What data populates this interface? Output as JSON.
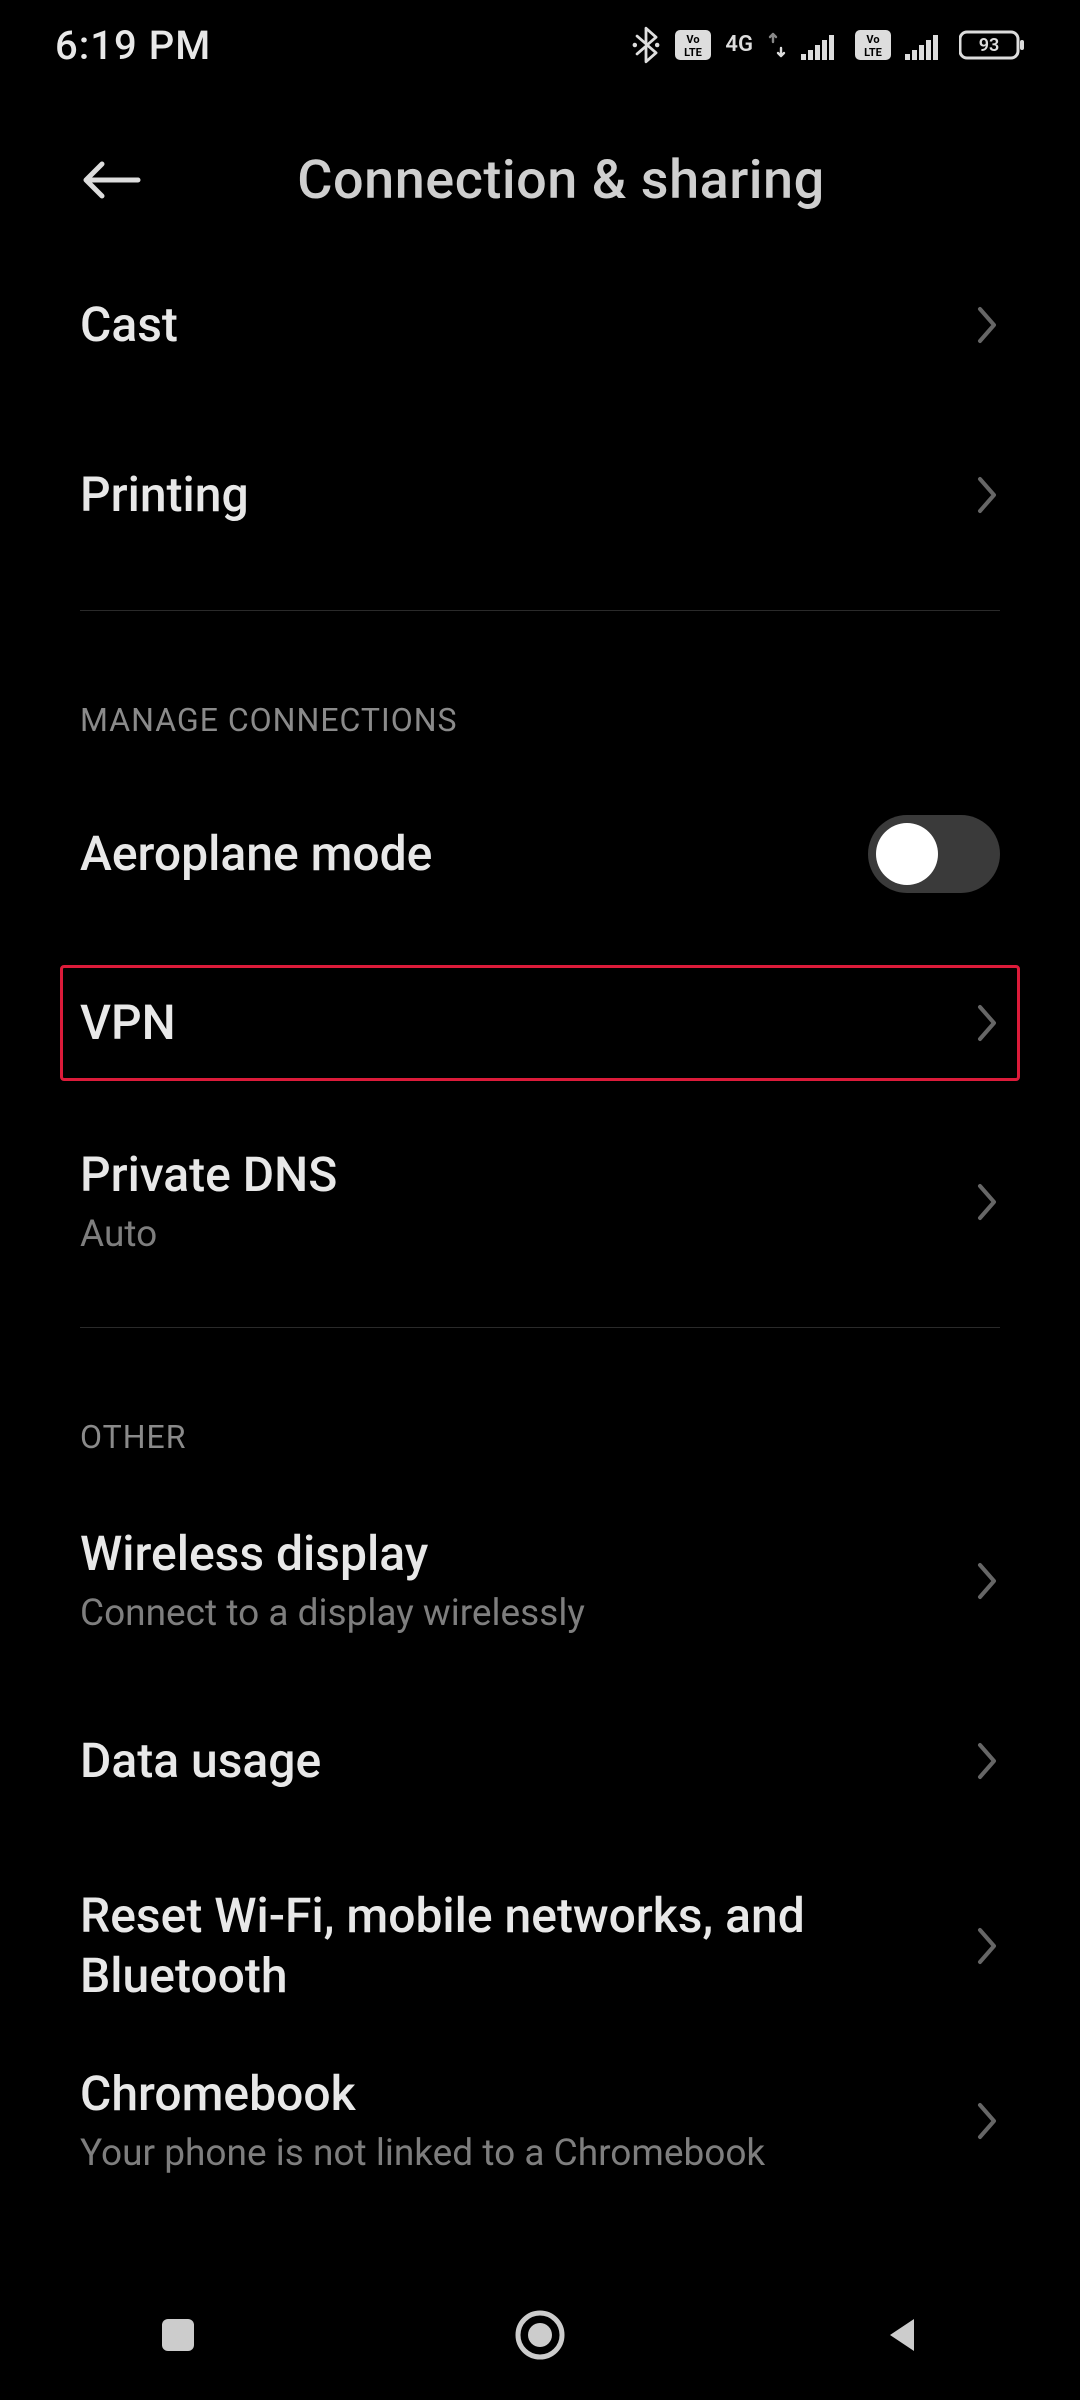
{
  "statusbar": {
    "time": "6:19 PM",
    "battery_percent": "93",
    "network_label": "4G"
  },
  "header": {
    "title": "Connection & sharing"
  },
  "items": {
    "cast": {
      "label": "Cast"
    },
    "printing": {
      "label": "Printing"
    },
    "aeroplane": {
      "label": "Aeroplane mode",
      "enabled": false
    },
    "vpn": {
      "label": "VPN"
    },
    "private_dns": {
      "label": "Private DNS",
      "sub": "Auto"
    },
    "wireless_disp": {
      "label": "Wireless display",
      "sub": "Connect to a display wirelessly"
    },
    "data_usage": {
      "label": "Data usage"
    },
    "reset": {
      "label": "Reset Wi-Fi, mobile networks, and Bluetooth"
    },
    "chromebook": {
      "label": "Chromebook",
      "sub": "Your phone is not linked to a Chromebook"
    }
  },
  "sections": {
    "manage": "MANAGE CONNECTIONS",
    "other": "OTHER"
  }
}
